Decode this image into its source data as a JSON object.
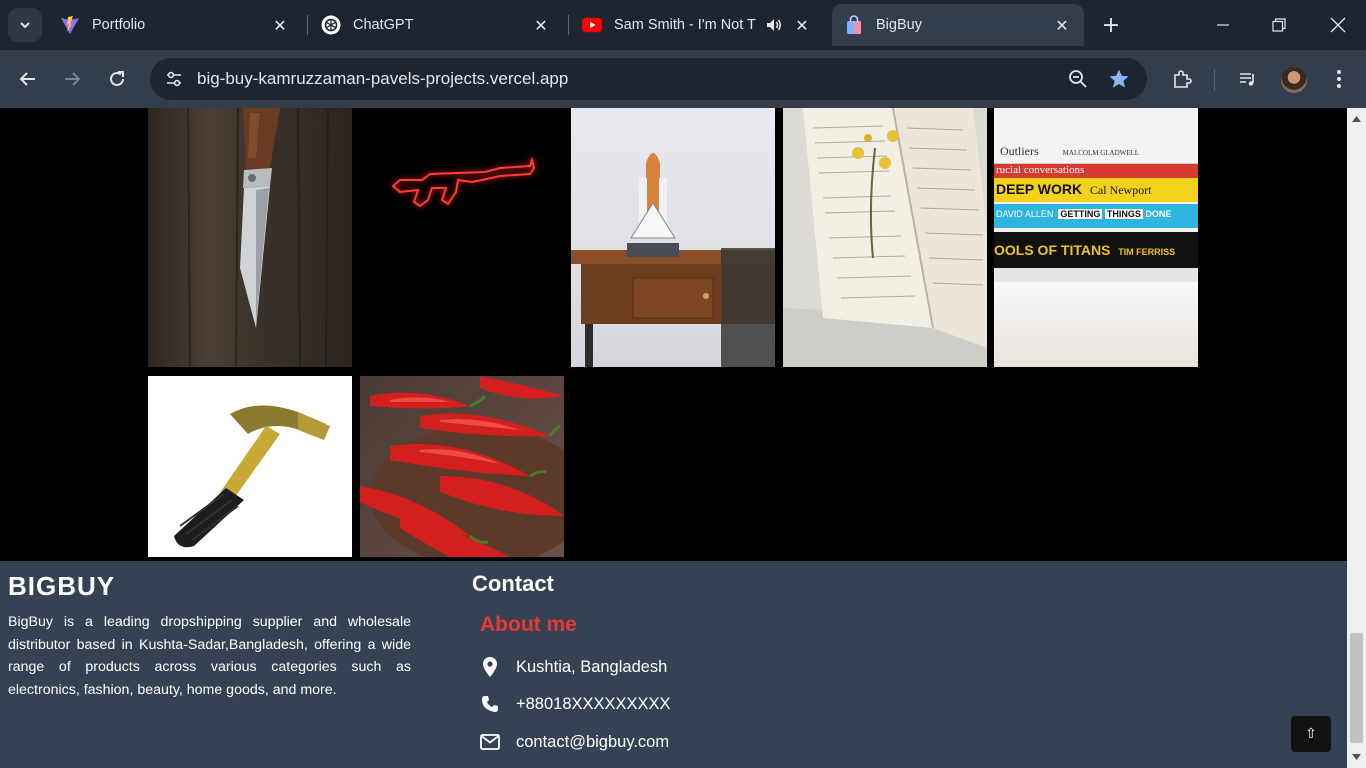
{
  "browser": {
    "tabs": [
      {
        "title": "Portfolio",
        "favicon": "vite-icon",
        "active": false
      },
      {
        "title": "ChatGPT",
        "favicon": "chatgpt-icon",
        "active": false
      },
      {
        "title": "Sam Smith - I'm Not T",
        "favicon": "youtube-icon",
        "active": false,
        "audio": true
      },
      {
        "title": "BigBuy",
        "favicon": "bag-icon",
        "active": true
      }
    ],
    "url": "big-buy-kamruzzaman-pavels-projects.vercel.app",
    "colors": {
      "tabbar": "#1e2530",
      "toolbar": "#333d4b",
      "star": "#8ab4f8"
    }
  },
  "products": [
    {
      "name": "knife",
      "icon": "knife-image"
    },
    {
      "name": "neon rifle",
      "icon": "neon-rifle-image"
    },
    {
      "name": "space shuttle model",
      "icon": "shuttle-image"
    },
    {
      "name": "open book with flowers",
      "icon": "book-image"
    },
    {
      "name": "stack of books",
      "icon": "books-stack-image",
      "spines": [
        "Outliers",
        "MALCOLM GLADWELL",
        "rucial conversations",
        "DEEP WORK",
        "Cal Newport",
        "DAVID ALLEN",
        "GETTING",
        "THINGS",
        "DONE",
        "OOLS OF TITANS",
        "TIM FERRISS"
      ]
    },
    {
      "name": "hammer",
      "icon": "hammer-image"
    },
    {
      "name": "red chilies",
      "icon": "chili-image"
    }
  ],
  "footer": {
    "brand": "BIGBUY",
    "about": "BigBuy is a leading dropshipping supplier and wholesale distributor based in Kushta-Sadar,Bangladesh, offering a wide range of products across various categories such as electronics, fashion, beauty, home goods, and more.",
    "contact_title": "Contact",
    "about_me": "About me",
    "address": "Kushtia, Bangladesh",
    "phone": "+88018XXXXXXXXX",
    "email": "contact@bigbuy.com",
    "colors": {
      "background": "#354254",
      "accent": "#e53935"
    }
  }
}
